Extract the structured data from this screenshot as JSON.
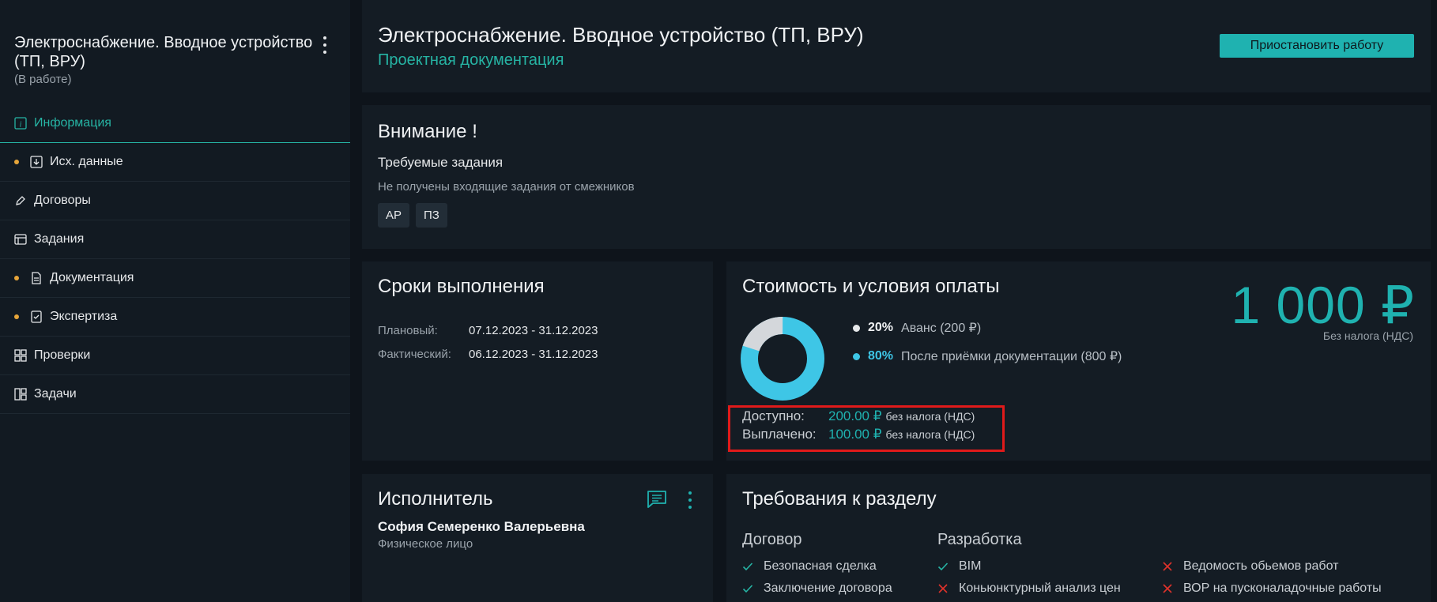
{
  "sidebar": {
    "title": "Электроснабжение. Вводное устройство (ТП, ВРУ)",
    "status": "(В работе)",
    "items": [
      {
        "label": "Информация",
        "icon": "info-icon",
        "active": true,
        "dot": false
      },
      {
        "label": "Исх. данные",
        "icon": "download-icon",
        "active": false,
        "dot": true
      },
      {
        "label": "Договоры",
        "icon": "pen-icon",
        "active": false,
        "dot": false
      },
      {
        "label": "Задания",
        "icon": "tasks-icon",
        "active": false,
        "dot": false
      },
      {
        "label": "Документация",
        "icon": "document-icon",
        "active": false,
        "dot": true
      },
      {
        "label": "Экспертиза",
        "icon": "checklist-icon",
        "active": false,
        "dot": true
      },
      {
        "label": "Проверки",
        "icon": "grid-icon",
        "active": false,
        "dot": false
      },
      {
        "label": "Задачи",
        "icon": "board-icon",
        "active": false,
        "dot": false
      }
    ]
  },
  "header": {
    "title": "Электроснабжение. Вводное устройство (ТП, ВРУ)",
    "subtitle": "Проектная документация",
    "pause_button": "Приостановить работу"
  },
  "attention": {
    "title": "Внимание !",
    "subtitle": "Требуемые задания",
    "note": "Не получены входящие задания от смежников",
    "chips": [
      "АР",
      "ПЗ"
    ]
  },
  "terms": {
    "title": "Сроки выполнения",
    "planned_label": "Плановый:",
    "planned_value": "07.12.2023 - 31.12.2023",
    "actual_label": "Фактический:",
    "actual_value": "06.12.2023 - 31.12.2023"
  },
  "cost": {
    "title": "Стоимость и условия оплаты",
    "price": "1 000 ₽",
    "price_note": "Без налога (НДС)",
    "advance_pct": "20%",
    "advance_desc": "Аванс (200 ₽)",
    "after_pct": "80%",
    "after_desc": "После приёмки документации (800 ₽)",
    "advance_fraction": 0.2,
    "available_label": "Доступно:",
    "available_amount": "200.00 ₽",
    "paid_label": "Выплачено:",
    "paid_amount": "100.00 ₽",
    "tax_note": "без налога (НДС)",
    "colors": {
      "advance": "#d4d7db",
      "after": "#3ec6e6"
    }
  },
  "executor": {
    "title": "Исполнитель",
    "name": "София Семеренко Валерьевна",
    "type": "Физическое лицо"
  },
  "requirements": {
    "title": "Требования к разделу",
    "group_contract": "Договор",
    "group_dev": "Разработка",
    "contract_items": [
      {
        "label": "Безопасная сделка",
        "ok": true
      },
      {
        "label": "Заключение договора",
        "ok": true
      }
    ],
    "dev_items": [
      {
        "label": "BIM",
        "ok": true
      },
      {
        "label": "Коньюнктурный анализ цен",
        "ok": false
      }
    ],
    "extra_items": [
      {
        "label": "Ведомость обьемов работ",
        "ok": false
      },
      {
        "label": "ВОР на пусконаладочные работы",
        "ok": false
      }
    ]
  }
}
